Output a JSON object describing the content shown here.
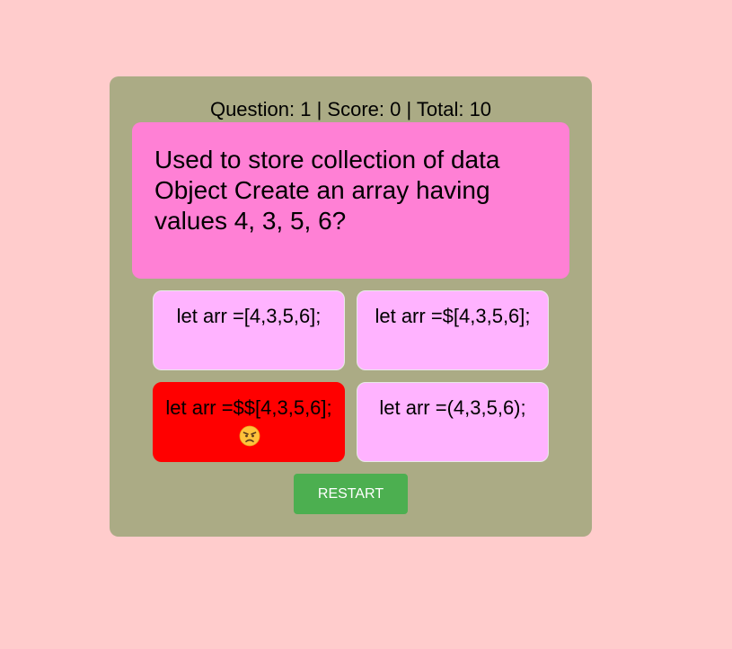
{
  "status": {
    "question_label": "Question:",
    "question_number": "1",
    "score_label": "Score:",
    "score": "0",
    "total_label": "Total:",
    "total": "10",
    "text": "Question: 1 | Score: 0 | Total: 10"
  },
  "question": {
    "text": "Used to store collection of data Object Create an array having values 4, 3, 5, 6?"
  },
  "answers": [
    {
      "label": "let arr =[4,3,5,6];",
      "state": "default"
    },
    {
      "label": "let arr =$[4,3,5,6];",
      "state": "default"
    },
    {
      "label": "let arr =$$[4,3,5,6];",
      "state": "wrong",
      "feedback_icon": "angry-face-icon"
    },
    {
      "label": "let arr =(4,3,5,6);",
      "state": "default"
    }
  ],
  "restart": {
    "label": "RESTART"
  },
  "colors": {
    "page_background": "#ffcccc",
    "card_background": "#abab85",
    "question_background": "#ff80d5",
    "answer_background": "#ffb3ff",
    "wrong_answer_background": "#ff0000",
    "restart_background": "#4caf50"
  }
}
